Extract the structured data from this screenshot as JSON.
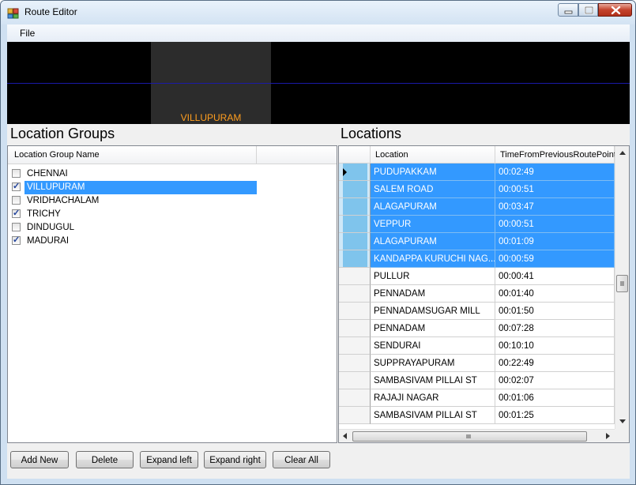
{
  "window": {
    "title": "Route Editor",
    "icon": "route-editor-app-icon"
  },
  "menu": {
    "file": "File"
  },
  "strip": {
    "label": "VILLUPURAM",
    "label_color": "#ff9e1f"
  },
  "groups": {
    "heading": "Location Groups",
    "column": "Location Group Name",
    "items": [
      {
        "label": "CHENNAI",
        "checked": false,
        "selected": false
      },
      {
        "label": "VILLUPURAM",
        "checked": true,
        "selected": true
      },
      {
        "label": "VRIDHACHALAM",
        "checked": false,
        "selected": false
      },
      {
        "label": "TRICHY",
        "checked": true,
        "selected": false
      },
      {
        "label": "DINDUGUL",
        "checked": false,
        "selected": false
      },
      {
        "label": "MADURAI",
        "checked": true,
        "selected": false
      }
    ]
  },
  "locations": {
    "heading": "Locations",
    "columns": [
      "Location",
      "TimeFromPreviousRoutePoint"
    ],
    "rows": [
      {
        "location": "PUDUPAKKAM",
        "time": "00:02:49",
        "selected": true,
        "current": true
      },
      {
        "location": "SALEM ROAD",
        "time": "00:00:51",
        "selected": true
      },
      {
        "location": "ALAGAPURAM",
        "time": "00:03:47",
        "selected": true
      },
      {
        "location": "VEPPUR",
        "time": "00:00:51",
        "selected": true
      },
      {
        "location": "ALAGAPURAM",
        "time": "00:01:09",
        "selected": true
      },
      {
        "location": "KANDAPPA KURUCHI NAG...",
        "time": "00:00:59",
        "selected": true
      },
      {
        "location": "PULLUR",
        "time": "00:00:41",
        "selected": false
      },
      {
        "location": "PENNADAM",
        "time": "00:01:40",
        "selected": false
      },
      {
        "location": "PENNADAMSUGAR MILL",
        "time": "00:01:50",
        "selected": false
      },
      {
        "location": "PENNADAM",
        "time": "00:07:28",
        "selected": false
      },
      {
        "location": "SENDURAI",
        "time": "00:10:10",
        "selected": false
      },
      {
        "location": "SUPPRAYAPURAM",
        "time": "00:22:49",
        "selected": false
      },
      {
        "location": "SAMBASIVAM PILLAI ST",
        "time": "00:02:07",
        "selected": false
      },
      {
        "location": "RAJAJI NAGAR",
        "time": "00:01:06",
        "selected": false
      },
      {
        "location": "SAMBASIVAM PILLAI ST",
        "time": "00:01:25",
        "selected": false
      }
    ]
  },
  "buttons": {
    "add_new": "Add New",
    "delete": "Delete",
    "expand_left": "Expand left",
    "expand_right": "Expand right",
    "clear_all": "Clear All"
  },
  "colors": {
    "selection": "#3399ff",
    "strip_bg": "#000000"
  }
}
